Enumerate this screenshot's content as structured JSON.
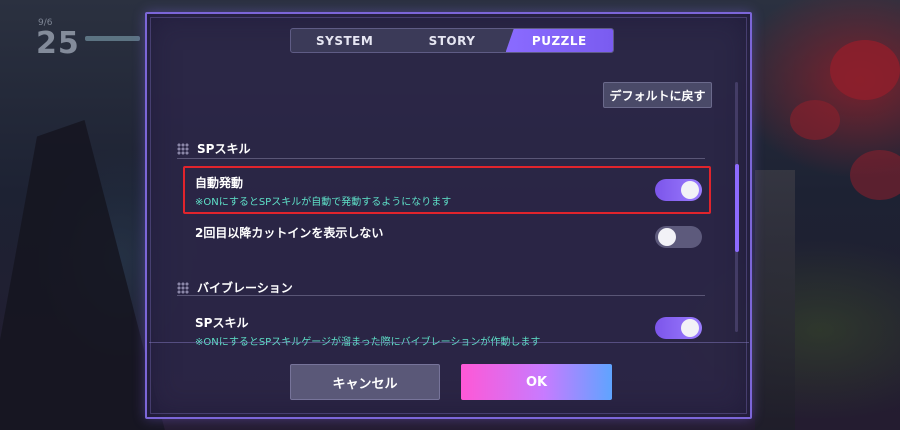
{
  "background": {
    "time": "25",
    "date": "9/6"
  },
  "tabs": [
    {
      "label": "SYSTEM",
      "active": false
    },
    {
      "label": "STORY",
      "active": false
    },
    {
      "label": "PUZZLE",
      "active": true
    }
  ],
  "default_button": "デフォルトに戻す",
  "sections": {
    "sp_skill": {
      "title": "SPスキル",
      "items": [
        {
          "label": "自動発動",
          "desc": "※ONにするとSPスキルが自動で発動するようになります",
          "state": "on"
        },
        {
          "label": "2回目以降カットインを表示しない",
          "desc": "",
          "state": "off"
        }
      ]
    },
    "vibration": {
      "title": "バイブレーション",
      "items": [
        {
          "label": "SPスキル",
          "desc": "※ONにするとSPスキルゲージが溜まった際にバイブレーションが作動します",
          "state": "on"
        }
      ]
    }
  },
  "buttons": {
    "cancel": "キャンセル",
    "ok": "OK"
  },
  "colors": {
    "accent": "#8a6bff",
    "highlight": "#e0242c",
    "desc_text": "#5ee0c8"
  }
}
